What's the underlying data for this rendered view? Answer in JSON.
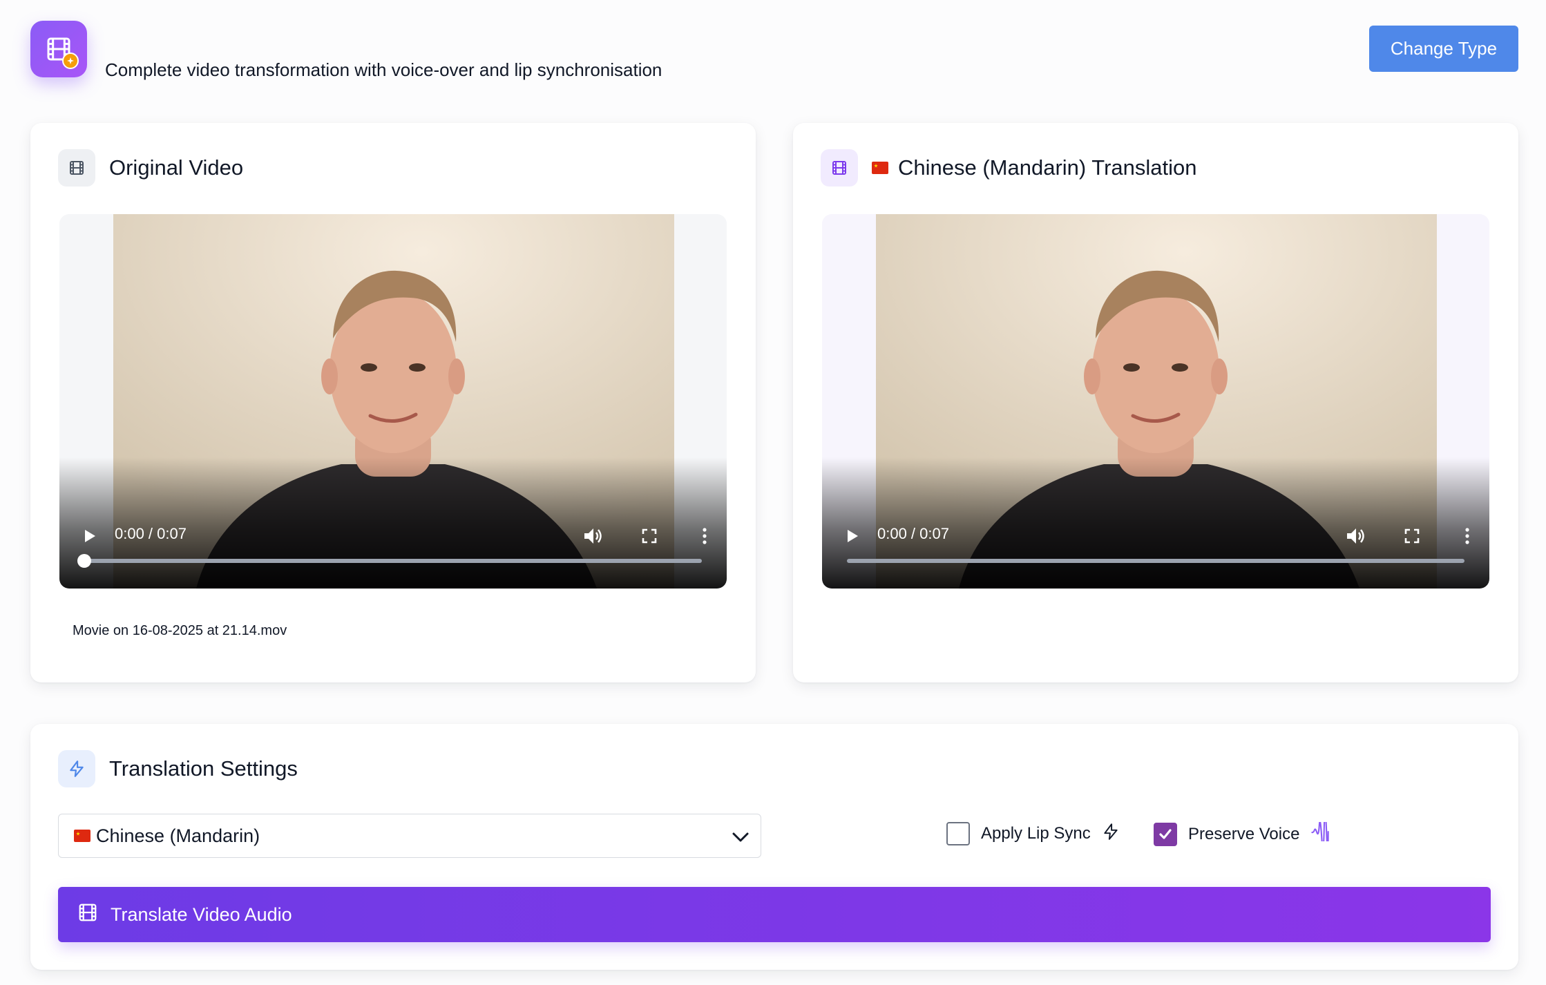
{
  "header": {
    "subtitle": "Complete video transformation with voice-over and lip synchronisation",
    "change_type_label": "Change Type",
    "app_icon": "film-sparkle-icon"
  },
  "original": {
    "title": "Original Video",
    "icon": "film-icon",
    "time": "0:00 / 0:07",
    "progress": 0,
    "filename": "Movie on 16-08-2025 at 21.14.mov"
  },
  "translation": {
    "title": "Chinese (Mandarin) Translation",
    "icon": "film-icon",
    "flag": "cn-flag-icon",
    "time": "0:00 / 0:07",
    "progress": 0
  },
  "settings": {
    "title": "Translation Settings",
    "icon": "zap-icon",
    "language_selected": "Chinese (Mandarin)",
    "apply_lip_sync_label": "Apply Lip Sync",
    "apply_lip_sync_checked": false,
    "preserve_voice_label": "Preserve Voice",
    "preserve_voice_checked": true,
    "translate_button_label": "Translate Video Audio"
  },
  "colors": {
    "accent_blue": "#4f88e9",
    "accent_purple": "#7c3aed",
    "checkbox_checked": "#7e3aa4"
  }
}
